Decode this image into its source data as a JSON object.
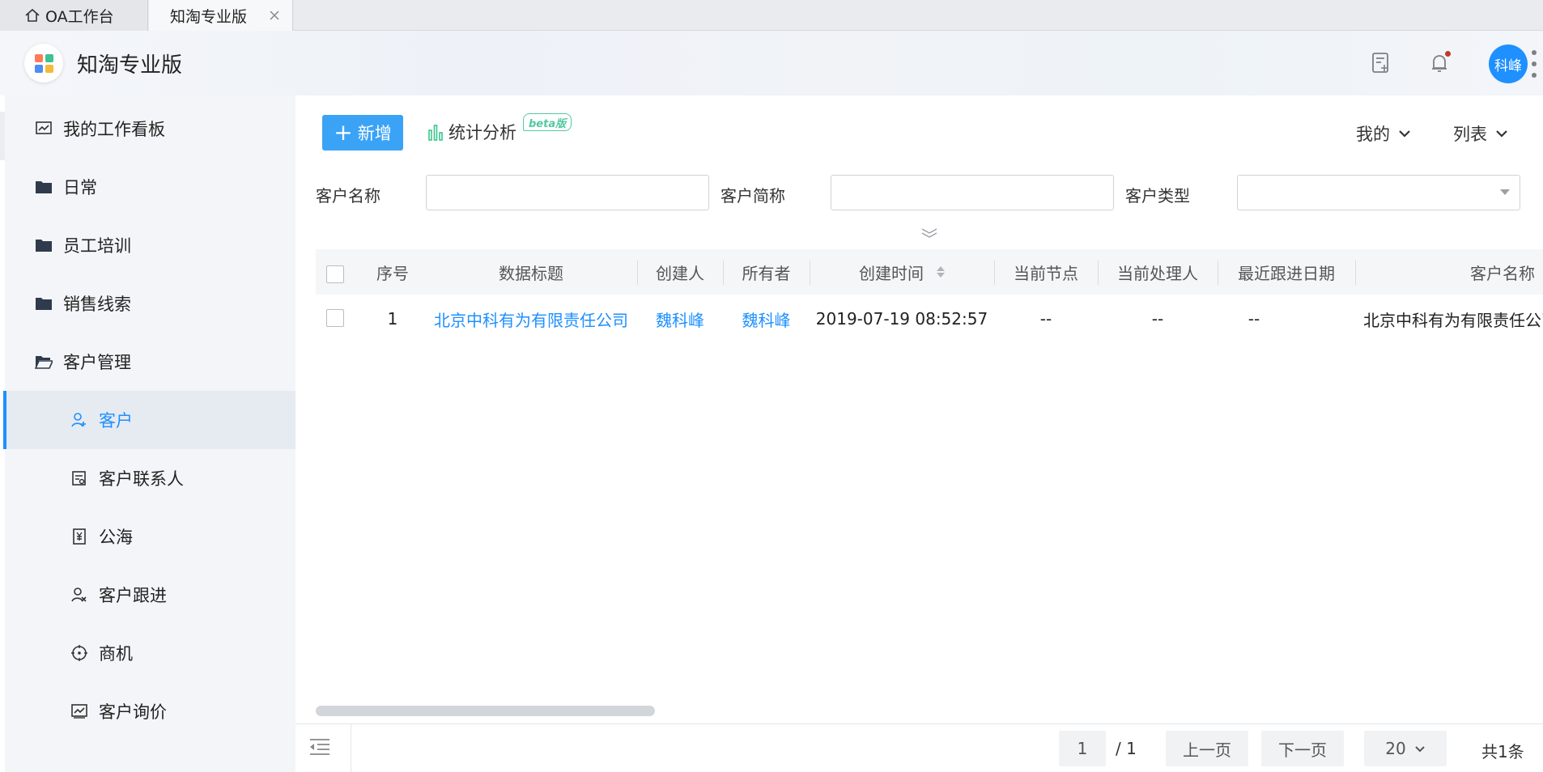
{
  "tabs": [
    {
      "label": "OA工作台",
      "icon": "home-icon"
    },
    {
      "label": "知淘专业版",
      "icon": "close-icon"
    }
  ],
  "header": {
    "app_title": "知淘专业版",
    "user_avatar": "科峰",
    "icons": [
      "task-icon",
      "bell-icon",
      "more-icon"
    ]
  },
  "sidebar": {
    "items": [
      {
        "label": "我的工作看板",
        "icon": "chart-board-icon"
      },
      {
        "label": "日常",
        "icon": "folder-icon"
      },
      {
        "label": "员工培训",
        "icon": "folder-icon"
      },
      {
        "label": "销售线索",
        "icon": "folder-icon"
      },
      {
        "label": "客户管理",
        "icon": "folder-open-icon"
      },
      {
        "label": "客户",
        "icon": "user-add-icon",
        "active": true
      },
      {
        "label": "客户联系人",
        "icon": "contact-card-icon"
      },
      {
        "label": "公海",
        "icon": "yen-doc-icon"
      },
      {
        "label": "客户跟进",
        "icon": "user-x-icon"
      },
      {
        "label": "商机",
        "icon": "target-icon"
      },
      {
        "label": "客户询价",
        "icon": "trend-chart-icon"
      }
    ]
  },
  "toolbar": {
    "add_label": "新增",
    "stats_label": "统计分析",
    "beta_badge": "beta版",
    "scope_dropdown": "我的",
    "view_dropdown": "列表"
  },
  "filters": {
    "customer_name_label": "客户名称",
    "customer_name_value": "",
    "customer_short_label": "客户简称",
    "customer_short_value": "",
    "customer_type_label": "客户类型",
    "customer_type_value": ""
  },
  "table": {
    "columns": [
      "序号",
      "数据标题",
      "创建人",
      "所有者",
      "创建时间",
      "当前节点",
      "当前处理人",
      "最近跟进日期",
      "客户名称"
    ],
    "rows": [
      {
        "index": "1",
        "title": "北京中科有为有限责任公司",
        "creator": "魏科峰",
        "owner": "魏科峰",
        "created_at": "2019-07-19 08:52:57",
        "current_node": "--",
        "current_handler": "--",
        "last_follow_date": "--",
        "customer_name": "北京中科有为有限责任公司"
      }
    ]
  },
  "pagination": {
    "current_page": "1",
    "total_pages": "/ 1",
    "prev_label": "上一页",
    "next_label": "下一页",
    "page_size": "20",
    "total_label": "共1条"
  },
  "colors": {
    "primary": "#1e90ff",
    "add_button": "#3aa3f5",
    "beta_badge": "#52c9a3",
    "stats_icon": "#3cc58f"
  }
}
